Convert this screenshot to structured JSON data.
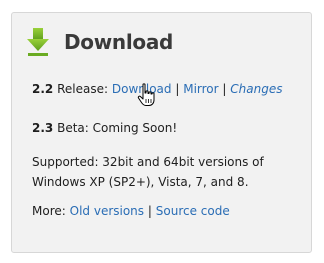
{
  "widget": {
    "title": "Download",
    "icon": "download-arrow-icon",
    "accent_color": "#79b729"
  },
  "release": {
    "version": "2.2",
    "label": "Release:",
    "links": {
      "download": "Download",
      "mirror": "Mirror",
      "changes": "Changes"
    },
    "separator": "|"
  },
  "beta": {
    "version": "2.3",
    "text": "Beta: Coming Soon!"
  },
  "supported": {
    "text": "Supported: 32bit and 64bit versions of Windows XP (SP2+), Vista, 7, and 8."
  },
  "more": {
    "label": "More:",
    "links": {
      "old_versions": "Old versions",
      "source_code": "Source code"
    },
    "separator": "|"
  },
  "cursor": {
    "icon": "hand-pointer-cursor-icon"
  },
  "colors": {
    "link": "#2a6db5",
    "panel_bg": "#f2f2f2",
    "panel_border": "#d7d7d7"
  }
}
